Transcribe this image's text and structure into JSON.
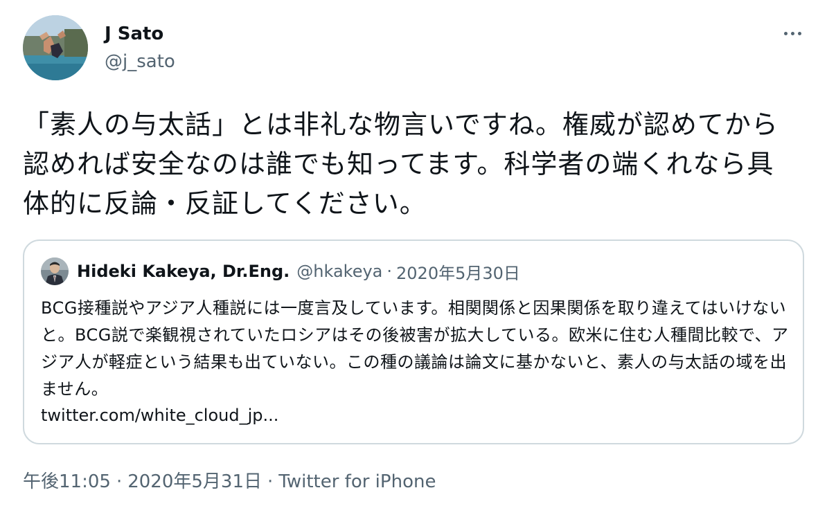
{
  "author": {
    "name": "J Sato",
    "handle": "@j_sato",
    "avatar_icon": "avatar-photo-person-jumping-pool"
  },
  "more_menu_icon": "more-horizontal-icon",
  "tweet_text": "「素人の与太話」とは非礼な物言いですね。権威が認めてから認めれば安全なのは誰でも知ってます。科学者の端くれなら具体的に反論・反証してください。",
  "quoted": {
    "name": "Hideki Kakeya, Dr.Eng.",
    "handle": "@hkakeya",
    "separator": "·",
    "date": "2020年5月30日",
    "avatar_icon": "avatar-photo-man-suit",
    "text": "BCG接種説やアジア人種説には一度言及しています。相関関係と因果関係を取り違えてはいけないと。BCG説で楽観視されていたロシアはその後被害が拡大している。欧米に住む人種間比較で、アジア人が軽症という結果も出ていない。この種の議論は論文に基かないと、素人の与太話の域を出ません。",
    "link": "twitter.com/white_cloud_jp..."
  },
  "meta": {
    "time": "午後11:05",
    "separator": "·",
    "date": "2020年5月31日",
    "source": "Twitter for iPhone"
  },
  "colors": {
    "text": "#0f1419",
    "secondary": "#536471",
    "border": "#cfd9de"
  }
}
